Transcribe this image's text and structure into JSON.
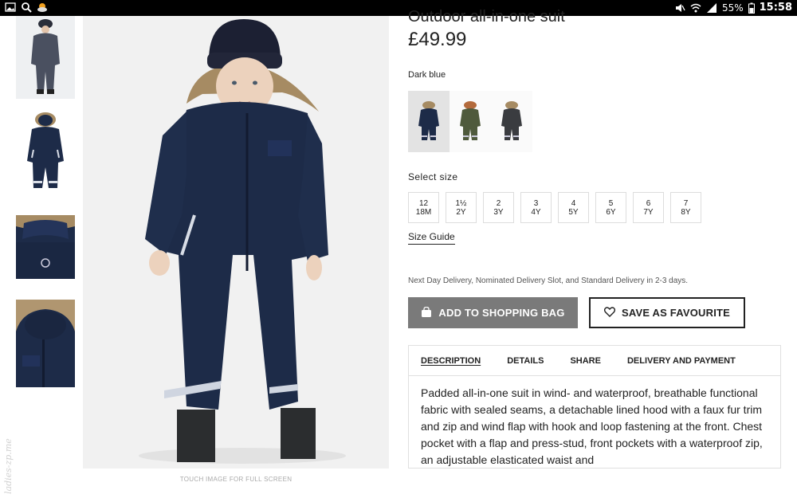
{
  "status_bar": {
    "battery_percent": "55%",
    "time": "15:58",
    "icons": [
      "image-icon",
      "search-icon",
      "weather-icon",
      "mute-icon",
      "wifi-icon",
      "signal-icon",
      "battery-icon"
    ]
  },
  "gallery": {
    "thumbnails": [
      "front-view",
      "back-view",
      "hood-back-detail",
      "hood-front-detail"
    ],
    "touch_hint": "TOUCH IMAGE FOR FULL SCREEN"
  },
  "product": {
    "title": "Outdoor all-in-one suit",
    "price": "£49.99",
    "selected_color": "Dark blue",
    "colors": [
      {
        "name": "dark-blue",
        "hex": "#1f2d4a"
      },
      {
        "name": "khaki-green",
        "hex": "#4f5a3c"
      },
      {
        "name": "dark-grey",
        "hex": "#3a3c40"
      }
    ],
    "size_label": "Select size",
    "sizes": [
      {
        "top": "12",
        "bottom": "18M"
      },
      {
        "top": "1½",
        "bottom": "2Y"
      },
      {
        "top": "2",
        "bottom": "3Y"
      },
      {
        "top": "3",
        "bottom": "4Y"
      },
      {
        "top": "4",
        "bottom": "5Y"
      },
      {
        "top": "5",
        "bottom": "6Y"
      },
      {
        "top": "6",
        "bottom": "7Y"
      },
      {
        "top": "7",
        "bottom": "8Y"
      }
    ],
    "size_guide": "Size Guide",
    "delivery_note": "Next Day Delivery, Nominated Delivery Slot, and Standard Delivery in 2-3 days.",
    "add_to_bag": "ADD TO SHOPPING BAG",
    "save_favourite": "SAVE AS FAVOURITE"
  },
  "info": {
    "tabs": [
      "DESCRIPTION",
      "DETAILS",
      "SHARE",
      "DELIVERY AND PAYMENT"
    ],
    "active_tab": "DESCRIPTION",
    "description": "Padded all-in-one suit in wind- and waterproof, breathable functional fabric with sealed seams, a detachable lined hood with a faux fur trim and zip and wind flap with hook and loop fastening at the front. Chest pocket with a flap and press-stud, front pockets with a waterproof zip, an adjustable elasticated waist and"
  },
  "watermark": "ladies-zp.me",
  "colors": {
    "suit_navy": "#1d2b48",
    "button_grey": "#7a7a7a",
    "fur": "#a68b63"
  }
}
